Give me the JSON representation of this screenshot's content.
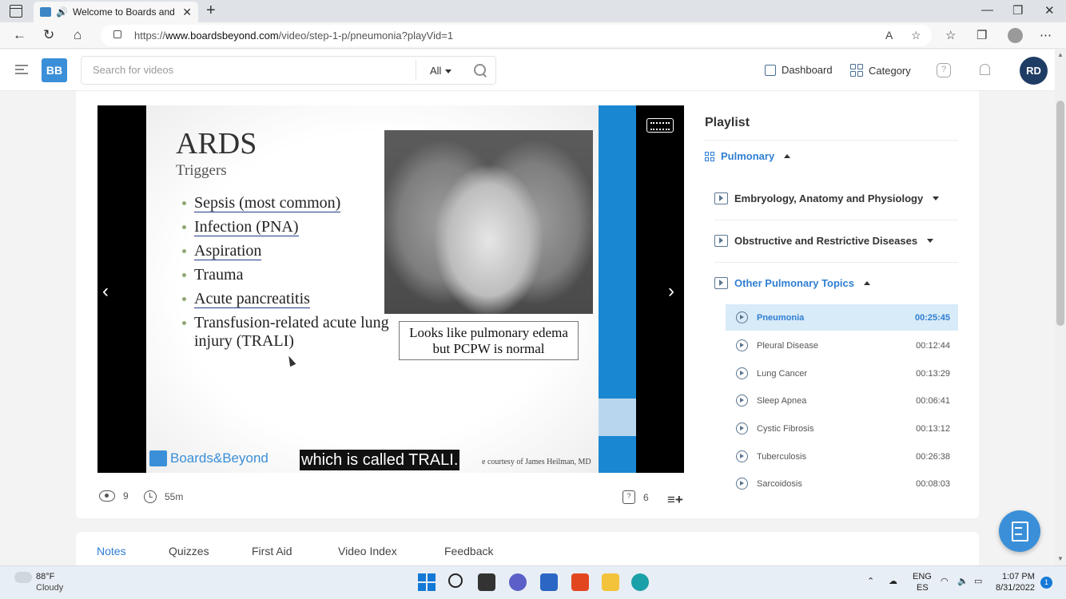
{
  "browser": {
    "tab_title": "Welcome to Boards and Beyond",
    "tab_close": "✕",
    "new_tab": "+",
    "url_prefix": "https://",
    "url_domain": "www.boardsbeyond.com",
    "url_path": "/video/step-1-p/pneumonia?playVid=1",
    "nav_back": "←",
    "nav_reload": "↻",
    "nav_home": "⌂",
    "win_min": "—",
    "win_max": "❐",
    "win_close": "✕",
    "read_aloud": "A",
    "fav_add": "☆",
    "favorites": "☆",
    "collections": "❐",
    "more": "⋯"
  },
  "header": {
    "logo_text": "BB",
    "search_placeholder": "Search for videos",
    "search_filter": "All",
    "dashboard_label": "Dashboard",
    "category_label": "Category",
    "help_glyph": "?",
    "avatar_initials": "RD"
  },
  "video": {
    "slide_title": "ARDS",
    "slide_subtitle": "Triggers",
    "bullets": [
      "Sepsis (most common)",
      "Infection (PNA)",
      "Aspiration",
      "Trauma",
      "Acute pancreatitis",
      "Transfusion-related acute lung injury (TRALI)"
    ],
    "xray_note": "Looks like pulmonary edema but PCPW is normal",
    "brand": "Boards&Beyond",
    "caption": "which is called TRALI.",
    "credit": "e courtesy of James Heilman, MD",
    "prev_glyph": "‹",
    "next_glyph": "›"
  },
  "stats": {
    "views": "9",
    "duration": "55m",
    "quiz_glyph": "?",
    "questions": "6",
    "add_to_list_glyph": "≡+"
  },
  "playlist": {
    "title": "Playlist",
    "section": "Pulmonary",
    "groups": [
      "Embryology, Anatomy and Physiology",
      "Obstructive and Restrictive Diseases",
      "Other Pulmonary Topics"
    ],
    "items": [
      {
        "title": "Pneumonia",
        "duration": "00:25:45"
      },
      {
        "title": "Pleural Disease",
        "duration": "00:12:44"
      },
      {
        "title": "Lung Cancer",
        "duration": "00:13:29"
      },
      {
        "title": "Sleep Apnea",
        "duration": "00:06:41"
      },
      {
        "title": "Cystic Fibrosis",
        "duration": "00:13:12"
      },
      {
        "title": "Tuberculosis",
        "duration": "00:26:38"
      },
      {
        "title": "Sarcoidosis",
        "duration": "00:08:03"
      }
    ]
  },
  "bottom_tabs": [
    "Notes",
    "Quizzes",
    "First Aid",
    "Video Index",
    "Feedback"
  ],
  "taskbar": {
    "temp": "88°F",
    "weather": "Cloudy",
    "lang_top": "ENG",
    "lang_bottom": "ES",
    "time": "1:07 PM",
    "date": "8/31/2022",
    "notifications": "1"
  },
  "colors": {
    "accent": "#2f7fd2",
    "video_side_bar": "#1a87d3",
    "avatar": "#1f3c64"
  }
}
